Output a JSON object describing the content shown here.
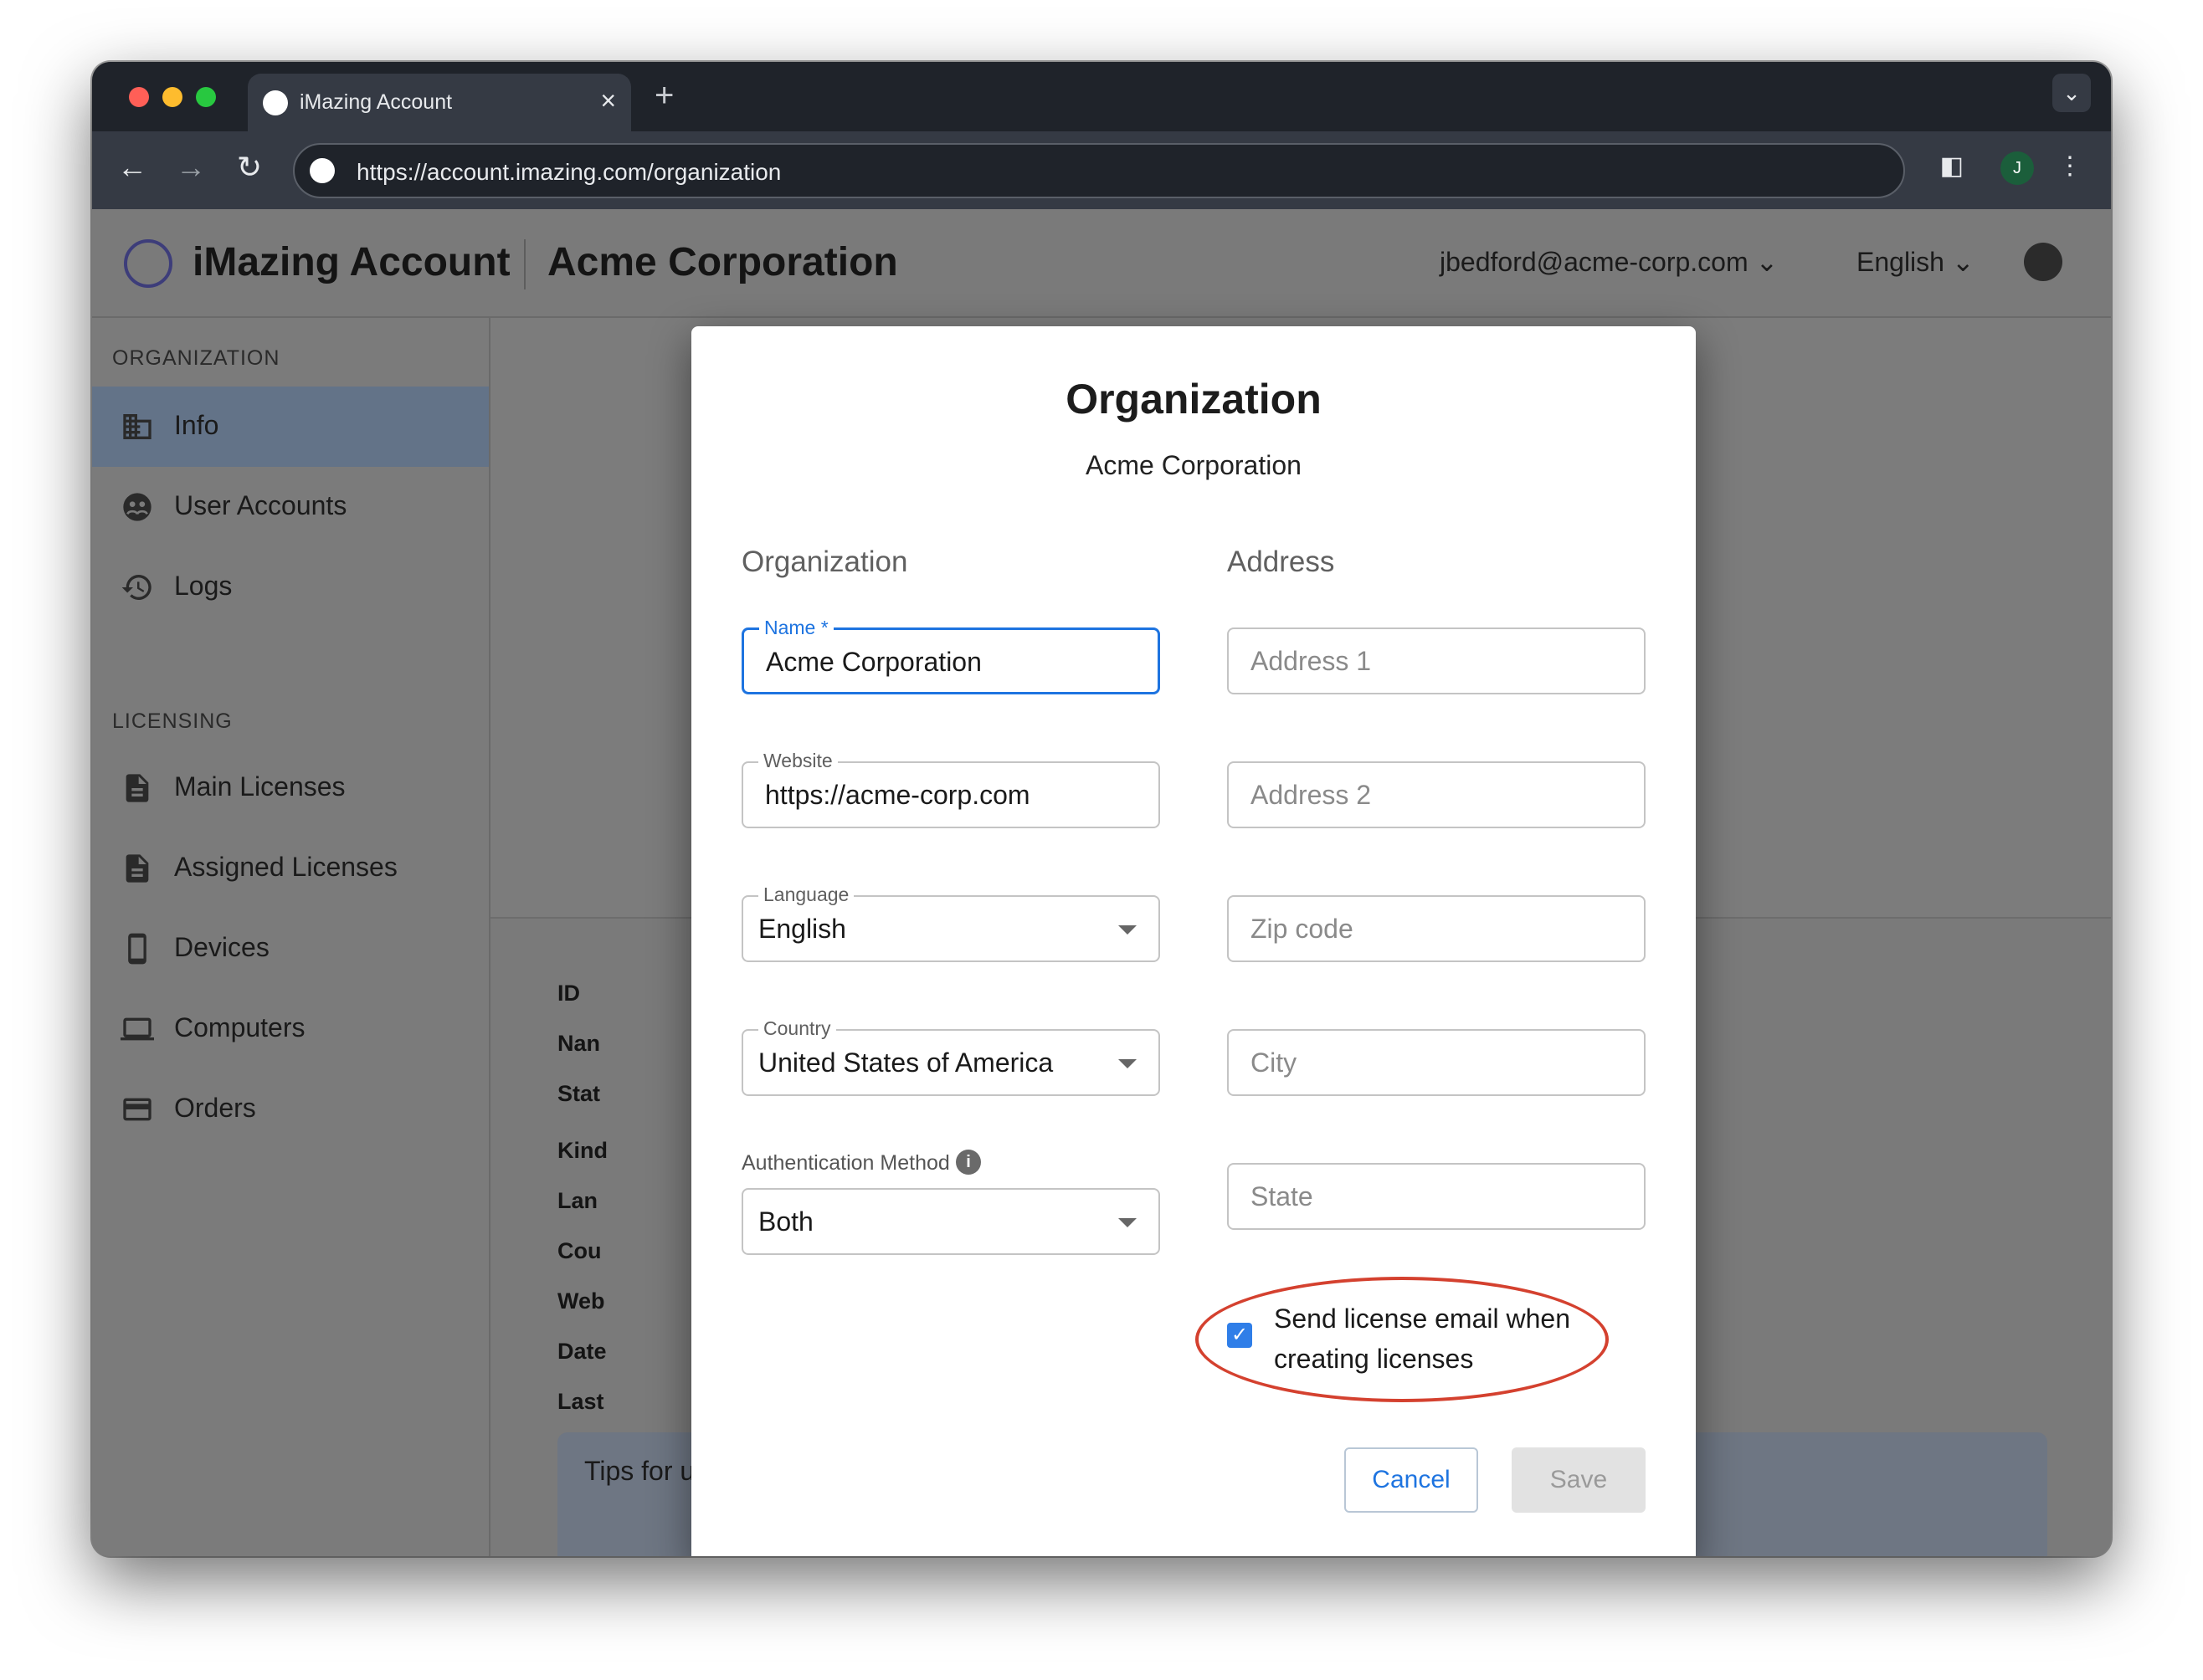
{
  "browser": {
    "tab_title": "iMazing Account",
    "tab_close": "×",
    "new_tab": "+",
    "url": "https://account.imazing.com/organization",
    "profile_initial": "J"
  },
  "header": {
    "brand": "iMazing Account",
    "org_name": "Acme Corporation",
    "user_email": "jbedford@acme-corp.com",
    "language": "English"
  },
  "sidebar": {
    "section_org": "ORGANIZATION",
    "section_licensing": "LICENSING",
    "items": [
      {
        "label": "Info"
      },
      {
        "label": "User Accounts"
      },
      {
        "label": "Logs"
      },
      {
        "label": "Main Licenses"
      },
      {
        "label": "Assigned Licenses"
      },
      {
        "label": "Devices"
      },
      {
        "label": "Computers"
      },
      {
        "label": "Orders"
      }
    ]
  },
  "content": {
    "labels": [
      "ID",
      "Nan",
      "Stat",
      "Kind",
      "Lan",
      "Cou",
      "Web",
      "Date",
      "Last"
    ],
    "tips": "Tips for using iMazing Account"
  },
  "modal": {
    "title": "Organization",
    "subtitle": "Acme Corporation",
    "col_org": "Organization",
    "col_address": "Address",
    "name_label": "Name *",
    "name_value": "Acme Corporation",
    "website_label": "Website",
    "website_value": "https://acme-corp.com",
    "language_label": "Language",
    "language_value": "English",
    "country_label": "Country",
    "country_value": "United States of America",
    "auth_label": "Authentication Method",
    "auth_value": "Both",
    "address1_ph": "Address 1",
    "address2_ph": "Address 2",
    "zip_ph": "Zip code",
    "city_ph": "City",
    "state_ph": "State",
    "send_email_label": "Send license email when creating licenses",
    "send_email_checked": true,
    "cancel": "Cancel",
    "save": "Save"
  },
  "colors": {
    "accent": "#1e74e0",
    "highlight_ellipse": "#d4412f",
    "active_nav": "#637388"
  }
}
